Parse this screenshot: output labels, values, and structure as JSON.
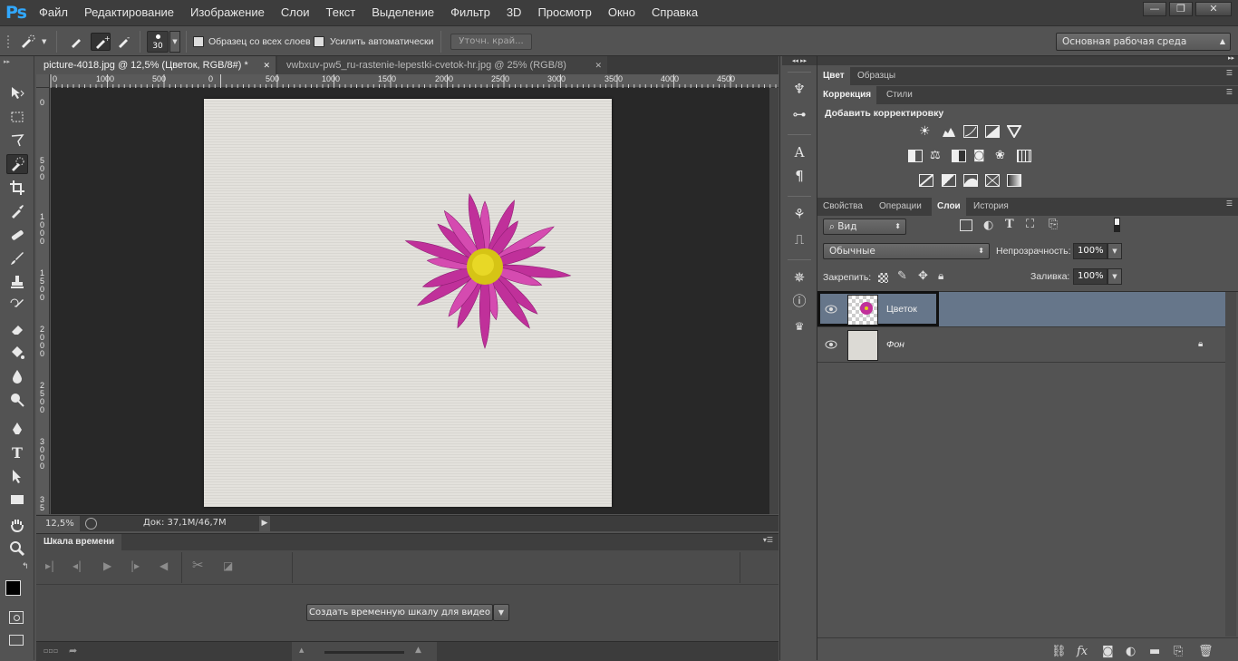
{
  "app": {
    "logo": "Ps"
  },
  "menu": [
    "Файл",
    "Редактирование",
    "Изображение",
    "Слои",
    "Текст",
    "Выделение",
    "Фильтр",
    "3D",
    "Просмотр",
    "Окно",
    "Справка"
  ],
  "window_controls": {
    "minimize": "—",
    "restore": "❐",
    "close": "✕"
  },
  "options": {
    "brush_size": "30",
    "sample_all_layers": "Образец со всех слоев",
    "auto_enhance": "Усилить автоматически",
    "refine_edge": "Уточн. край...",
    "workspace": "Основная рабочая среда"
  },
  "documents": [
    {
      "title": "picture-4018.jpg @ 12,5% (Цветок, RGB/8#) *",
      "active": true
    },
    {
      "title": "vwbxuv-pw5_ru-rastenie-lepestki-cvetok-hr.jpg @ 25% (RGB/8)",
      "active": false
    }
  ],
  "ruler": {
    "top": [
      "0",
      "1000",
      "500",
      "0",
      "500",
      "1000",
      "1500",
      "2000",
      "2500",
      "3000",
      "3500",
      "4000",
      "4500"
    ],
    "left": [
      [
        "0"
      ],
      [
        "5",
        "0",
        "0"
      ],
      [
        "1",
        "0",
        "0",
        "0"
      ],
      [
        "1",
        "5",
        "0",
        "0"
      ],
      [
        "2",
        "0",
        "0",
        "0"
      ],
      [
        "2",
        "5",
        "0",
        "0"
      ],
      [
        "3",
        "0",
        "0",
        "0"
      ],
      [
        "3",
        "5"
      ]
    ]
  },
  "status": {
    "zoom": "12,5%",
    "doc_size": "Док: 37,1M/46,7M"
  },
  "timeline": {
    "tab": "Шкала времени",
    "create_button": "Создать временную шкалу для видео"
  },
  "panels": {
    "color_tabs": [
      "Цвет",
      "Образцы"
    ],
    "adjust_tabs": [
      "Коррекция",
      "Стили"
    ],
    "add_adjustment": "Добавить корректировку",
    "layer_tabs": [
      "Свойства",
      "Операции",
      "Слои",
      "История"
    ],
    "filter_kind": "Вид",
    "blend_mode": "Обычные",
    "opacity_label": "Непрозрачность:",
    "opacity_value": "100%",
    "lock_label": "Закрепить:",
    "fill_label": "Заливка:",
    "fill_value": "100%"
  },
  "layers": [
    {
      "name": "Цветок",
      "selected": true
    },
    {
      "name": "Фон",
      "selected": false,
      "locked": true
    }
  ],
  "colors": {
    "accent": "#31a8ff",
    "selected_layer": "#66768a",
    "flower": "#c0309a",
    "flower_center": "#e2d01a",
    "paper": "#e2e0db"
  }
}
